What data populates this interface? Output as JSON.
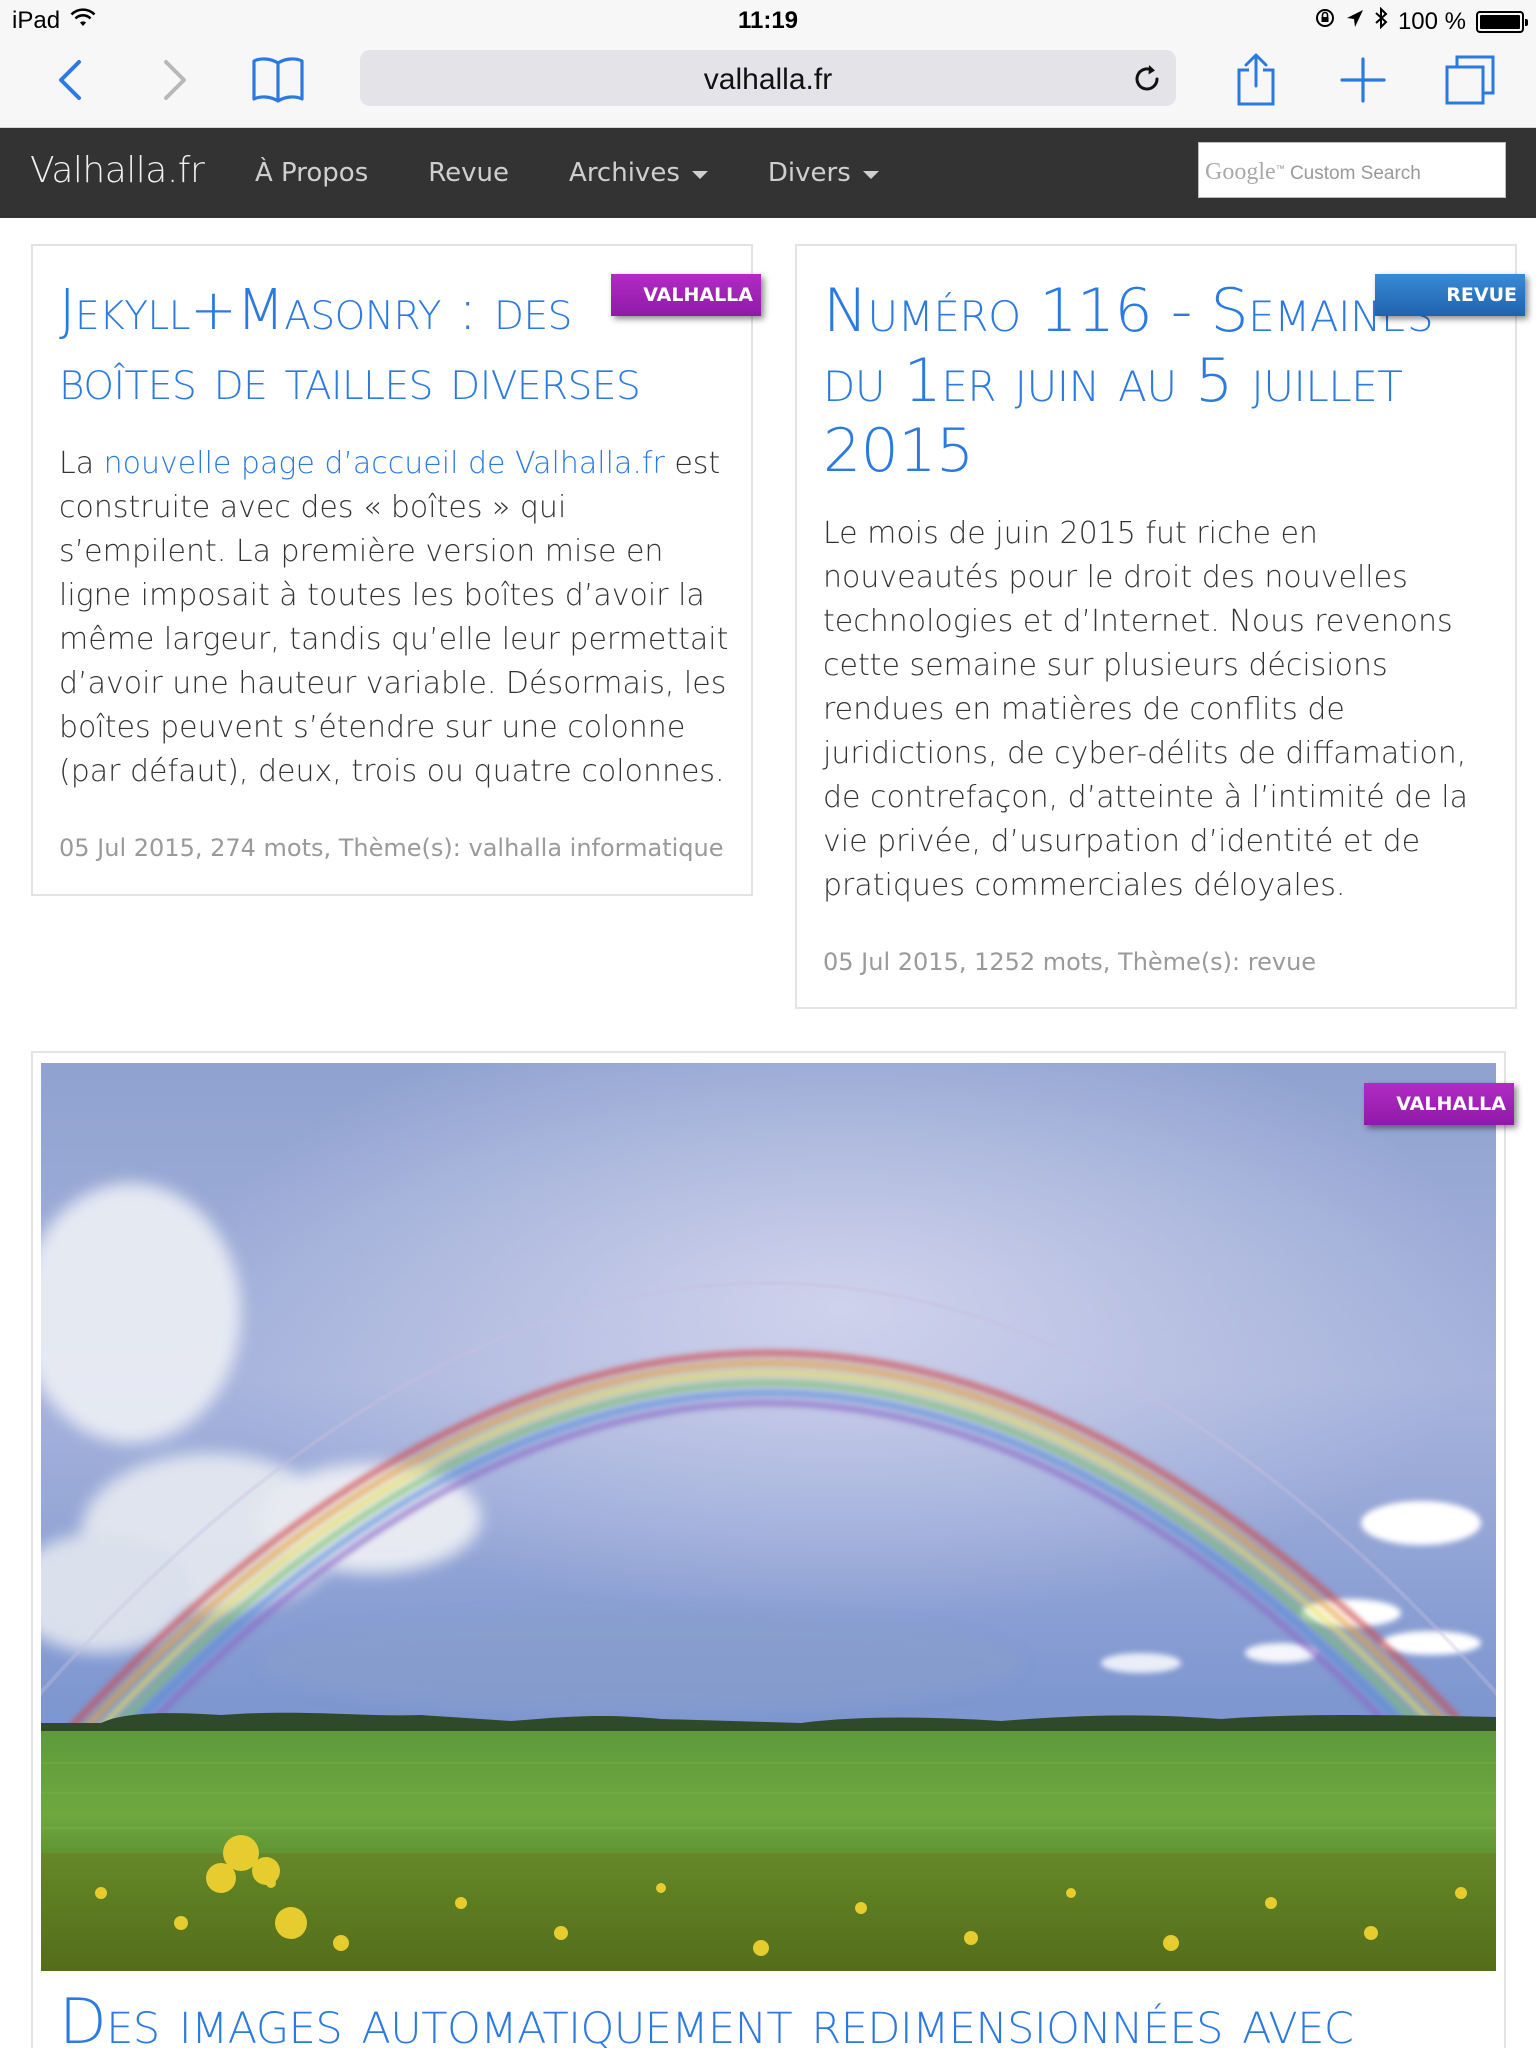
{
  "status": {
    "device": "iPad",
    "time": "11:19",
    "battery": "100 %"
  },
  "browser": {
    "url": "valhalla.fr"
  },
  "site": {
    "brand": "Valhalla.fr",
    "nav": [
      {
        "label": "À Propos"
      },
      {
        "label": "Revue"
      },
      {
        "label": "Archives"
      },
      {
        "label": "Divers"
      }
    ],
    "search": {
      "logo": "Google",
      "tm": "™",
      "placeholder": "Custom Search"
    }
  },
  "posts": [
    {
      "tag": "VALHALLA",
      "title": "Jekyll+Masonry : des boîtes de tailles diverses",
      "excerpt_prefix": "La ",
      "excerpt_link": "nouvelle page d’accueil de Valhalla.fr",
      "excerpt_rest": " est construite avec des « boîtes » qui s’empilent. La première version mise en ligne imposait à toutes les boîtes d’avoir la même largeur, tandis qu’elle leur permettait d’avoir une hauteur variable. Désormais, les boîtes peuvent s’étendre sur une colonne (par défaut), deux, trois ou quatre colonnes.",
      "meta": "05 Jul 2015, 274 mots, Thème(s): valhalla informatique"
    },
    {
      "tag": "REVUE",
      "title": "Numéro 116 - Semaines du 1er juin au 5 juillet 2015",
      "excerpt": "Le mois de juin 2015 fut riche en nouveautés pour le droit des nouvelles technologies et d’Internet. Nous revenons cette semaine sur plusieurs décisions rendues en matières de conflits de juridictions, de cyber-délits de diffamation, de contrefaçon, d’atteinte à l’intimité de la vie privée, d’usurpation d’identité et de pratiques commerciales déloyales.",
      "meta": "05 Jul 2015, 1252 mots, Thème(s): revue"
    },
    {
      "tag": "VALHALLA",
      "title": "Des images automatiquement redimensionnées avec"
    }
  ]
}
